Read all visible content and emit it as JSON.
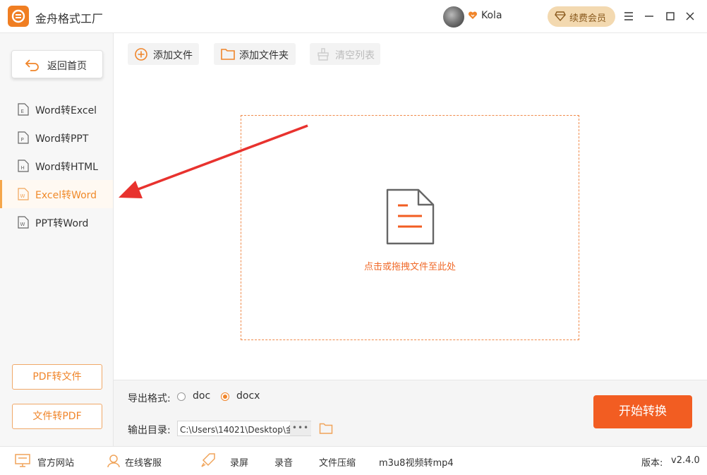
{
  "app": {
    "title": "金舟格式工厂",
    "username": "Kola",
    "renew_label": "续费会员"
  },
  "sidebar": {
    "home_label": "返回首页",
    "items": [
      {
        "label": "Word转Excel",
        "icon_letter": "E"
      },
      {
        "label": "Word转PPT",
        "icon_letter": "P"
      },
      {
        "label": "Word转HTML",
        "icon_letter": "H"
      },
      {
        "label": "Excel转Word",
        "icon_letter": "W",
        "active": true
      },
      {
        "label": "PPT转Word",
        "icon_letter": "W"
      }
    ],
    "pdf_to_file_label": "PDF转文件",
    "file_to_pdf_label": "文件转PDF"
  },
  "toolbar": {
    "add_file_label": "添加文件",
    "add_folder_label": "添加文件夹",
    "clear_list_label": "清空列表"
  },
  "dropzone": {
    "hint": "点击或拖拽文件至此处"
  },
  "settings": {
    "format_label": "导出格式:",
    "format_options": [
      {
        "label": "doc",
        "checked": false
      },
      {
        "label": "docx",
        "checked": true
      }
    ],
    "output_label": "输出目录:",
    "output_path": "C:\\Users\\14021\\Desktop\\金",
    "more_label": "•••",
    "start_label": "开始转换"
  },
  "statusbar": {
    "website_label": "官方网站",
    "service_label": "在线客服",
    "record_screen_label": "录屏",
    "record_audio_label": "录音",
    "compress_label": "文件压缩",
    "m3u8_label": "m3u8视频转mp4",
    "version_label": "版本:",
    "version_value": "v2.4.0"
  },
  "colors": {
    "accent": "#f0852a",
    "start_button": "#f25d22",
    "annotation_arrow": "#e8322e"
  }
}
